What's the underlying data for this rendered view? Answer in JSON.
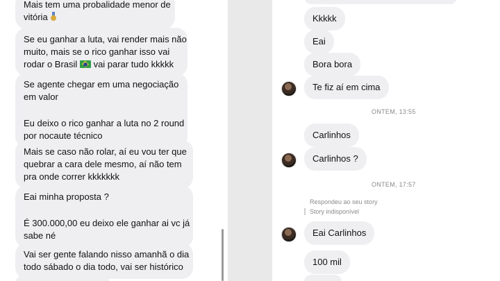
{
  "left_thread": {
    "messages": [
      {
        "lines": [
          "Mais tem uma probalidade menor de",
          "vitória"
        ],
        "emoji": "medal-emoji"
      },
      {
        "lines": [
          "Se eu ganhar a luta, vai render mais não",
          "muito, mais se o rico ganhar isso vai",
          "rodar o Brasil",
          "vai parar tudo kkkkk"
        ],
        "emoji": "brazil-flag-emoji"
      },
      {
        "paragraphs": [
          [
            "Se agente chegar em uma negociação",
            "em valor"
          ],
          [
            "Eu deixo o rico ganhar a luta no 2 round",
            "por nocaute técnico"
          ]
        ]
      },
      {
        "lines": [
          "Mais se caso não rolar, aí eu vou ter que",
          "quebrar a cara dele mesmo, aí não tem",
          "pra onde correr kkkkkkk"
        ]
      },
      {
        "paragraphs": [
          [
            "Eai minha proposta ?"
          ],
          [
            "É 300.000,00 eu deixo ele ganhar ai vc já",
            "sabe né"
          ]
        ]
      },
      {
        "lines": [
          "Vai ser gente falando nisso amanhã o dia",
          "todo sábado o dia todo, vai ser histórico"
        ]
      }
    ]
  },
  "right_thread": {
    "messages": [
      {
        "text": "Kkkkk"
      },
      {
        "text": "Eai"
      },
      {
        "text": "Bora bora"
      },
      {
        "text": "Te fiz aí em cima"
      },
      {
        "text": "Carlinhos"
      },
      {
        "text": "Carlinhos ?"
      },
      {
        "text": "Eai Carlinhos"
      },
      {
        "text": "100 mil"
      }
    ],
    "timestamps": [
      "ONTEM, 13:55",
      "ONTEM, 17:57"
    ],
    "reply_note": "Respondeu ao seu story",
    "story_ref": "Story indisponível"
  }
}
